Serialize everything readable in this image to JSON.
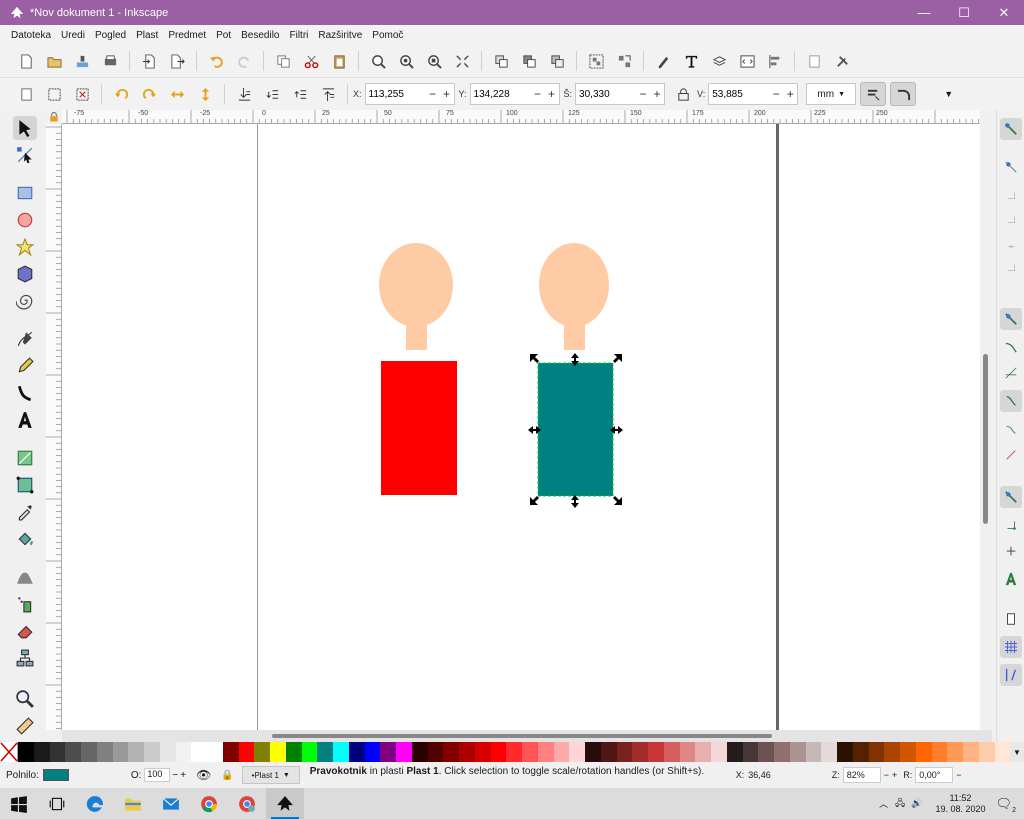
{
  "window": {
    "title": "*Nov dokument 1 - Inkscape",
    "minimize": "—",
    "maximize": "☐",
    "close": "✕"
  },
  "menu": [
    "Datoteka",
    "Uredi",
    "Pogled",
    "Plast",
    "Predmet",
    "Pot",
    "Besedilo",
    "Filtri",
    "Razširitve",
    "Pomoč"
  ],
  "controls": {
    "x_label": "X:",
    "x_value": "113,255",
    "y_label": "Y:",
    "y_value": "134,228",
    "w_label": "Š:",
    "w_value": "30,330",
    "h_label": "V:",
    "h_value": "53,885",
    "unit": "mm"
  },
  "ruler": {
    "top_ticks": [
      "-75",
      "-50",
      "-25",
      "0",
      "25",
      "50",
      "75",
      "100",
      "125",
      "150",
      "175",
      "200",
      "225",
      "250"
    ]
  },
  "shapes": {
    "head_color": "#ffcba4",
    "left_body_color": "#ff0000",
    "right_body_color": "#008080",
    "page_border_color": "#666666"
  },
  "palette": [
    "#000000",
    "#1a1a1a",
    "#333333",
    "#4d4d4d",
    "#666666",
    "#808080",
    "#999999",
    "#b3b3b3",
    "#cccccc",
    "#e6e6e6",
    "#f2f2f2",
    "#ffffff",
    "#ffffff",
    "#800000",
    "#ff0000",
    "#808000",
    "#ffff00",
    "#008000",
    "#00ff00",
    "#008080",
    "#00ffff",
    "#000080",
    "#0000ff",
    "#800080",
    "#ff00ff",
    "#2b0000",
    "#550000",
    "#800000",
    "#aa0000",
    "#d40000",
    "#ff0000",
    "#ff2a2a",
    "#ff5555",
    "#ff8080",
    "#ffaaaa",
    "#ffd5d5",
    "#280b0b",
    "#501616",
    "#782121",
    "#a02c2c",
    "#c83737",
    "#d35f5f",
    "#de8787",
    "#e9afaf",
    "#f4d7d7",
    "#241c1c",
    "#483737",
    "#6c5353",
    "#916f6f",
    "#ac9393",
    "#c8b7b7",
    "#e3dbdb",
    "#2b1100",
    "#552200",
    "#803300",
    "#aa4400",
    "#d45500",
    "#ff6600",
    "#ff7f2a",
    "#ff9955",
    "#ffb380",
    "#ffccaa",
    "#ffe6d5"
  ],
  "status": {
    "fill_label": "Polnilo:",
    "fill_color": "#008080",
    "opacity_label": "O:",
    "opacity_value": "100",
    "layer": "•Plast 1",
    "message_object": "Pravokotnik",
    "message_mid": " in plasti ",
    "message_layer": "Plast 1",
    "message_tail": ". Click selection to toggle scale/rotation handles (or Shift+s).",
    "x_label": "X:",
    "x_value": "36,46",
    "zoom_label": "Z:",
    "zoom_value": "82%",
    "rotation_label": "R:",
    "rotation_value": "0,00°"
  },
  "taskbar": {
    "time": "11:52",
    "date": "19. 08. 2020",
    "notifications": "2"
  }
}
